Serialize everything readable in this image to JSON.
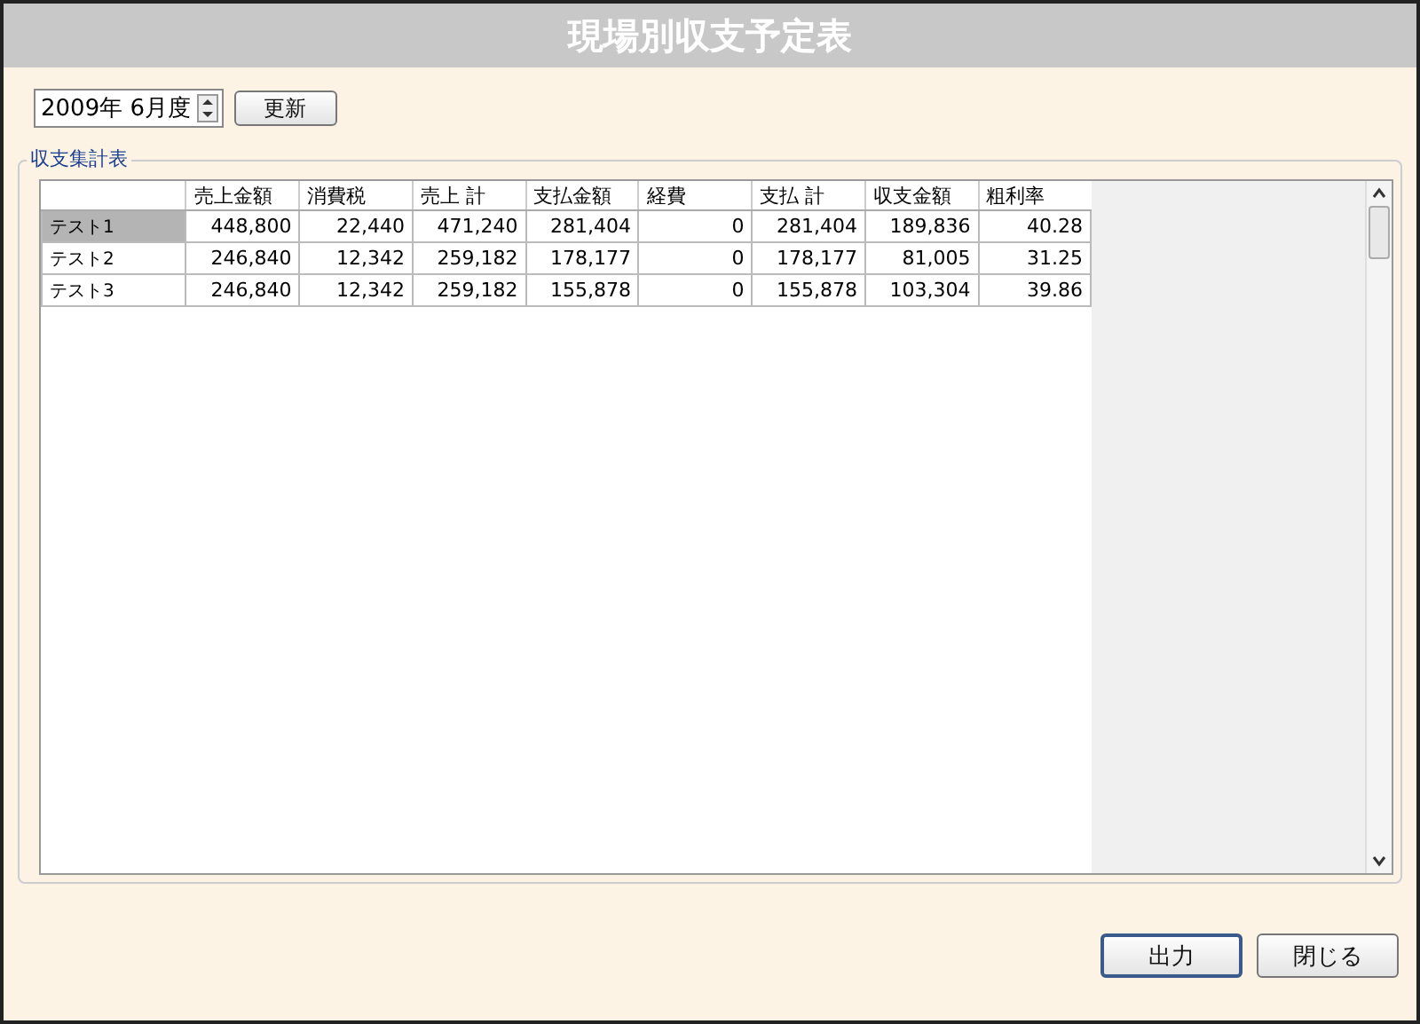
{
  "window": {
    "title": "現場別収支予定表"
  },
  "period": {
    "value": "2009年 6月度"
  },
  "update_button": "更新",
  "group": {
    "label": "収支集計表"
  },
  "table": {
    "columns": [
      "売上金額",
      "消費税",
      "売上 計",
      "支払金額",
      "経費",
      "支払 計",
      "収支金額",
      "粗利率"
    ],
    "rows": [
      {
        "name": "テスト1",
        "selected": true,
        "cells": [
          "448,800",
          "22,440",
          "471,240",
          "281,404",
          "0",
          "281,404",
          "189,836",
          "40.28"
        ]
      },
      {
        "name": "テスト2",
        "selected": false,
        "cells": [
          "246,840",
          "12,342",
          "259,182",
          "178,177",
          "0",
          "178,177",
          "81,005",
          "31.25"
        ]
      },
      {
        "name": "テスト3",
        "selected": false,
        "cells": [
          "246,840",
          "12,342",
          "259,182",
          "155,878",
          "0",
          "155,878",
          "103,304",
          "39.86"
        ]
      }
    ]
  },
  "buttons": [
    {
      "label": "出力",
      "default": true
    },
    {
      "label": "閉じる",
      "default": false
    }
  ]
}
